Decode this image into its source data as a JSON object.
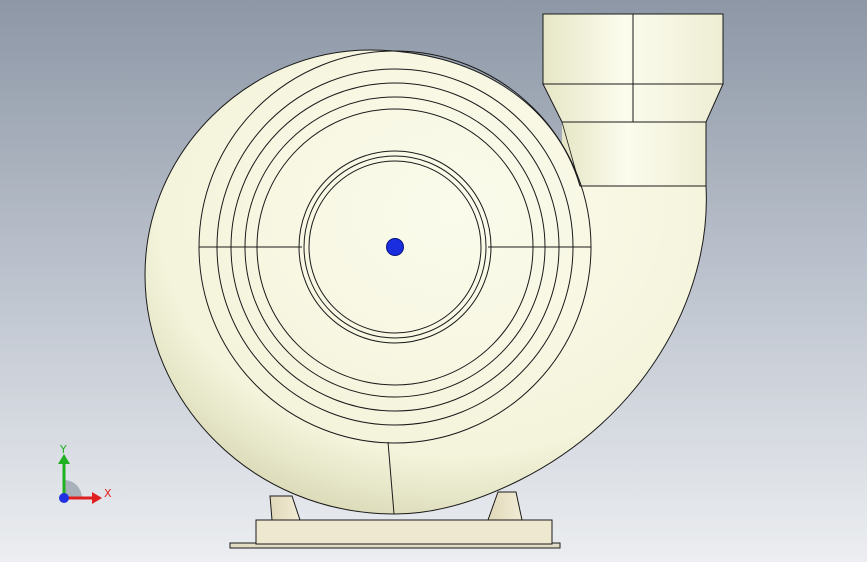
{
  "viewport": {
    "background_top": "#8d97a6",
    "background_bottom": "#eceef1"
  },
  "model": {
    "body_color": "#f6f6e2",
    "body_shade": "#d8d8b8",
    "edge_color": "#1a1a1a",
    "base_color": "#eae2c6",
    "origin_point_color": "#1a2ee0"
  },
  "triad": {
    "x_label": "X",
    "y_label": "Y",
    "x_color": "#e02020",
    "y_color": "#20b020",
    "z_color": "#2030e0"
  }
}
